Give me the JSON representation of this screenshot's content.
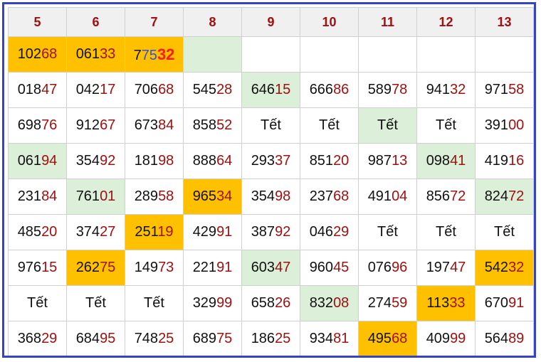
{
  "columns": [
    "5",
    "6",
    "7",
    "8",
    "9",
    "10",
    "11",
    "12",
    "13"
  ],
  "rows": [
    [
      {
        "a": "102",
        "b": "68",
        "bg": "gold"
      },
      {
        "a": "061",
        "b": "33",
        "bg": "gold"
      },
      {
        "special": true,
        "p1": "7",
        "p2": "75",
        "p3": "32",
        "bg": "gold"
      },
      {
        "a": "",
        "b": "",
        "bg": "green"
      },
      {
        "a": "",
        "b": ""
      },
      {
        "a": "",
        "b": ""
      },
      {
        "a": "",
        "b": ""
      },
      {
        "a": "",
        "b": ""
      },
      {
        "a": "",
        "b": ""
      }
    ],
    [
      {
        "a": "018",
        "b": "47"
      },
      {
        "a": "042",
        "b": "17"
      },
      {
        "a": "706",
        "b": "68"
      },
      {
        "a": "545",
        "b": "28"
      },
      {
        "a": "646",
        "b": "15",
        "bg": "green"
      },
      {
        "a": "666",
        "b": "86"
      },
      {
        "a": "589",
        "b": "78"
      },
      {
        "a": "941",
        "b": "32"
      },
      {
        "a": "971",
        "b": "58"
      }
    ],
    [
      {
        "a": "698",
        "b": "76"
      },
      {
        "a": "912",
        "b": "67"
      },
      {
        "a": "673",
        "b": "84"
      },
      {
        "a": "858",
        "b": "52"
      },
      {
        "tet": "Tết"
      },
      {
        "tet": "Tết"
      },
      {
        "tet": "Tết",
        "bg": "green"
      },
      {
        "tet": "Tết"
      },
      {
        "a": "391",
        "b": "00"
      }
    ],
    [
      {
        "a": "061",
        "b": "94",
        "bg": "green"
      },
      {
        "a": "354",
        "b": "92"
      },
      {
        "a": "181",
        "b": "98"
      },
      {
        "a": "888",
        "b": "64"
      },
      {
        "a": "293",
        "b": "37"
      },
      {
        "a": "851",
        "b": "20"
      },
      {
        "a": "987",
        "b": "13"
      },
      {
        "a": "098",
        "b": "41",
        "bg": "green"
      },
      {
        "a": "419",
        "b": "16"
      }
    ],
    [
      {
        "a": "231",
        "b": "84"
      },
      {
        "a": "761",
        "b": "01",
        "bg": "green"
      },
      {
        "a": "289",
        "b": "58"
      },
      {
        "a": "965",
        "b": "34",
        "bg": "gold"
      },
      {
        "a": "354",
        "b": "98"
      },
      {
        "a": "237",
        "b": "68"
      },
      {
        "a": "491",
        "b": "04"
      },
      {
        "a": "856",
        "b": "72"
      },
      {
        "a": "824",
        "b": "72",
        "bg": "green"
      }
    ],
    [
      {
        "a": "485",
        "b": "20"
      },
      {
        "a": "374",
        "b": "27"
      },
      {
        "a": "251",
        "b": "19",
        "bg": "gold"
      },
      {
        "a": "429",
        "b": "91"
      },
      {
        "a": "387",
        "b": "92"
      },
      {
        "a": "046",
        "b": "29"
      },
      {
        "tet": "Tết"
      },
      {
        "tet": "Tết"
      },
      {
        "tet": "Tết"
      }
    ],
    [
      {
        "a": "976",
        "b": "15"
      },
      {
        "a": "262",
        "b": "75",
        "bg": "gold"
      },
      {
        "a": "149",
        "b": "73"
      },
      {
        "a": "221",
        "b": "91"
      },
      {
        "a": "603",
        "b": "47",
        "bg": "green"
      },
      {
        "a": "960",
        "b": "45"
      },
      {
        "a": "076",
        "b": "96"
      },
      {
        "a": "197",
        "b": "47"
      },
      {
        "a": "542",
        "b": "32",
        "bg": "gold"
      }
    ],
    [
      {
        "tet": "Tết"
      },
      {
        "tet": "Tết"
      },
      {
        "tet": "Tết"
      },
      {
        "a": "329",
        "b": "99"
      },
      {
        "a": "658",
        "b": "26"
      },
      {
        "a": "832",
        "b": "08",
        "bg": "green"
      },
      {
        "a": "274",
        "b": "59"
      },
      {
        "a": "113",
        "b": "33",
        "bg": "gold"
      },
      {
        "a": "670",
        "b": "91"
      }
    ],
    [
      {
        "a": "368",
        "b": "29"
      },
      {
        "a": "684",
        "b": "95"
      },
      {
        "a": "748",
        "b": "25"
      },
      {
        "a": "689",
        "b": "75"
      },
      {
        "a": "186",
        "b": "25"
      },
      {
        "a": "934",
        "b": "81"
      },
      {
        "a": "495",
        "b": "68",
        "bg": "gold"
      },
      {
        "a": "409",
        "b": "99"
      },
      {
        "a": "564",
        "b": "89"
      }
    ]
  ]
}
